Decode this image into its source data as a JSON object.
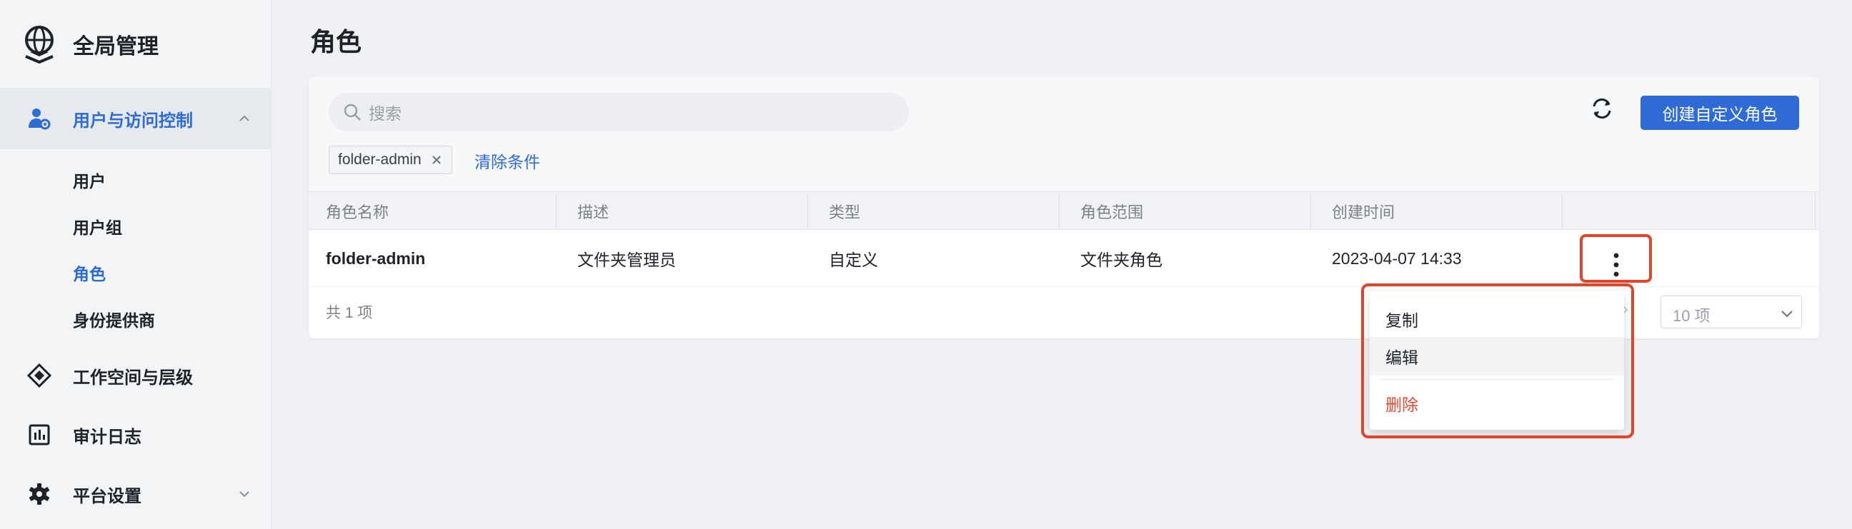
{
  "app": {
    "title": "全局管理"
  },
  "sidebar": {
    "groups": [
      {
        "label": "用户与访问控制",
        "icon": "user-gear-icon",
        "expanded": true
      },
      {
        "label": "工作空间与层级",
        "icon": "layers-diamond-icon"
      },
      {
        "label": "审计日志",
        "icon": "audit-chart-icon"
      },
      {
        "label": "平台设置",
        "icon": "gear-icon",
        "expanded": false
      }
    ],
    "sub_items": [
      {
        "label": "用户"
      },
      {
        "label": "用户组"
      },
      {
        "label": "角色",
        "active": true
      },
      {
        "label": "身份提供商"
      }
    ]
  },
  "page": {
    "title": "角色"
  },
  "toolbar": {
    "search_placeholder": "搜索",
    "filter_chip": "folder-admin",
    "clear_label": "清除条件",
    "create_label": "创建自定义角色"
  },
  "table": {
    "columns": [
      "角色名称",
      "描述",
      "类型",
      "角色范围",
      "创建时间"
    ],
    "rows": [
      {
        "name": "folder-admin",
        "description": "文件夹管理员",
        "type": "自定义",
        "scope": "文件夹角色",
        "created": "2023-04-07 14:33"
      }
    ],
    "total_label": "共 1 项",
    "page_size": "10 项"
  },
  "row_menu": {
    "items": [
      "复制",
      "编辑",
      "删除"
    ]
  },
  "colors": {
    "accent": "#2e6bd7",
    "highlight": "#e0452a",
    "danger": "#e04b36"
  }
}
